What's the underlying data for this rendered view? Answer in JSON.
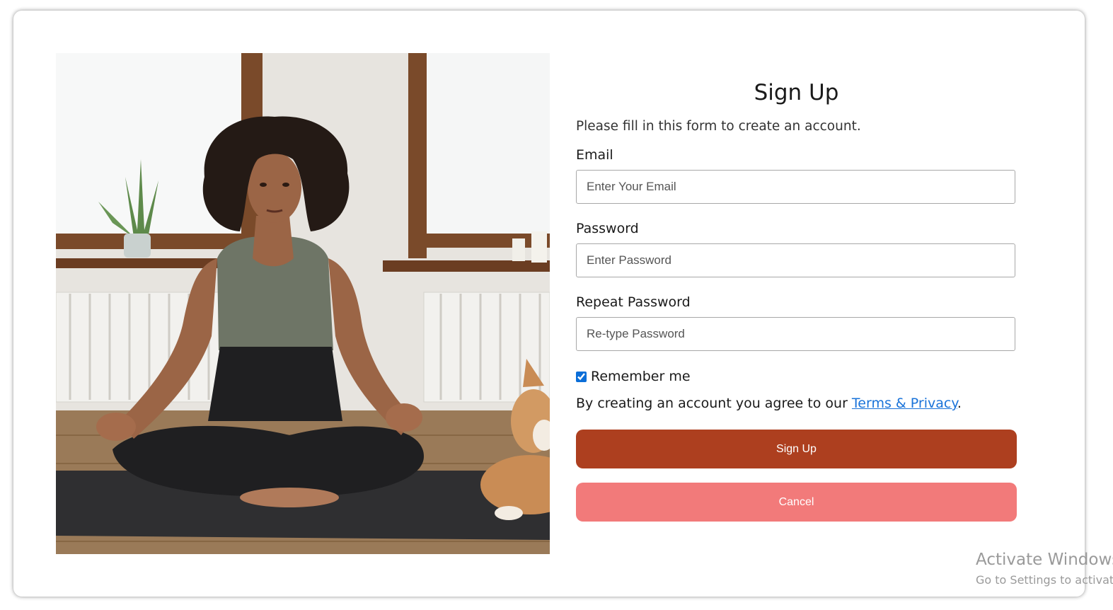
{
  "form": {
    "title": "Sign Up",
    "subtitle": "Please fill in this form to create an account.",
    "email_label": "Email",
    "email_placeholder": "Enter Your Email",
    "password_label": "Password",
    "password_placeholder": "Enter Password",
    "repeat_label": "Repeat Password",
    "repeat_placeholder": "Re-type Password",
    "remember_label": "Remember me",
    "remember_checked": true,
    "terms_prefix": "By creating an account you agree to our ",
    "terms_link": "Terms & Privacy",
    "terms_suffix": ".",
    "signup_button": "Sign Up",
    "cancel_button": "Cancel"
  },
  "colors": {
    "signup_button": "#ad3f1f",
    "cancel_button": "#f27a7a",
    "link": "#1a73d9"
  },
  "image": {
    "subject": "woman meditating in lotus pose on yoga mat with dog beside her"
  },
  "watermark": {
    "line1": "Activate Windows",
    "line2": "Go to Settings to activate Windows."
  }
}
